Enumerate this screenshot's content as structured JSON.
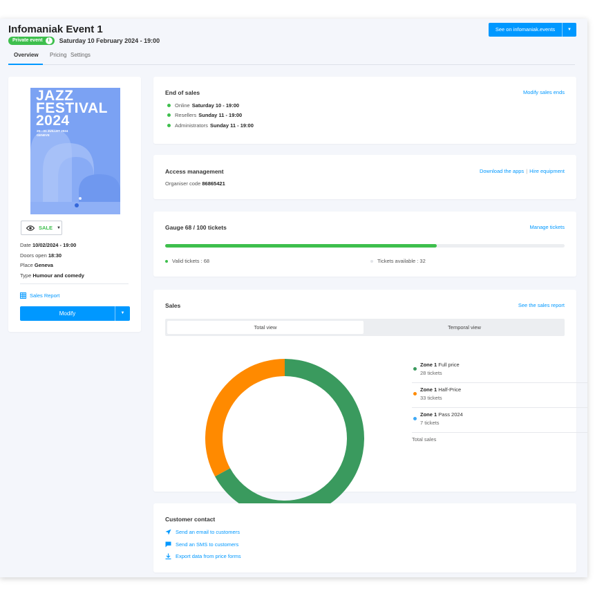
{
  "header": {
    "title": "Infomaniak Event 1",
    "badge_label": "Private event",
    "badge_icon": "i",
    "date": "Saturday 10 February 2024 - 19:00",
    "see_button_label": "See on infomaniak.events"
  },
  "tabs": [
    {
      "label": "Overview",
      "active": true
    },
    {
      "label": "Pricing",
      "active": false
    },
    {
      "label": "Settings",
      "active": false
    }
  ],
  "event_card": {
    "poster": {
      "line1": "JAZZ",
      "line2": "FESTIVAL",
      "line3": "2024",
      "dates": "29—31 JUILLET 2024",
      "city": "GENEVE"
    },
    "status_label": "SALE",
    "details": [
      {
        "label": "Date",
        "value": "10/02/2024 - 19:00"
      },
      {
        "label": "Doors open",
        "value": "18:30"
      },
      {
        "label": "Place",
        "value": "Geneva"
      },
      {
        "label": "Type",
        "value": "Humour and comedy"
      }
    ],
    "sales_report_label": "Sales Report",
    "modify_label": "Modify"
  },
  "end_of_sales": {
    "title": "End of sales",
    "link": "Modify sales ends",
    "items": [
      {
        "channel": "Online",
        "date": "Saturday 10 - 19:00"
      },
      {
        "channel": "Resellers",
        "date": "Sunday 11 - 19:00"
      },
      {
        "channel": "Administrators",
        "date": "Sunday 11 - 19:00"
      }
    ],
    "dot_color": "#3ebf4d"
  },
  "access": {
    "title": "Access management",
    "organiser_label": "Organiser code",
    "organiser_code": "86865421",
    "link_download": "Download the apps",
    "link_separator": "|",
    "link_hire": "Hire equipment"
  },
  "gauge": {
    "title": "Gauge 68 / 100 tickets",
    "link": "Manage tickets",
    "fill_fraction": 0.68,
    "valid_label": "Valid tickets : 68",
    "available_label": "Tickets available : 32",
    "fill_color": "#3ebf4d"
  },
  "sales": {
    "title": "Sales",
    "link": "See the sales report",
    "view_tabs": [
      {
        "label": "Total view",
        "active": true
      },
      {
        "label": "Temporal view",
        "active": false
      }
    ],
    "legend": [
      {
        "zone": "Zone 1",
        "name": "Full price",
        "count": "28 tickets",
        "color": "#3a9a5e"
      },
      {
        "zone": "Zone 1",
        "name": "Half-Price",
        "count": "33 tickets",
        "color": "#ff8a00"
      },
      {
        "zone": "Zone 1",
        "name": "Pass 2024",
        "count": "7 tickets",
        "color": "#3fa9f5"
      }
    ],
    "total_label": "Total sales"
  },
  "chart_data": {
    "type": "pie",
    "categories": [
      "Zone 1 Full price",
      "Zone 1 Half-Price"
    ],
    "values": [
      59,
      29
    ],
    "colors": [
      "#3a9a5e",
      "#ff8a00"
    ]
  },
  "contact": {
    "title": "Customer contact",
    "items": [
      {
        "label": "Send an email to customers",
        "icon": "send-icon"
      },
      {
        "label": "Send an SMS to customers",
        "icon": "chat-icon"
      },
      {
        "label": "Export data from price forms",
        "icon": "download-icon"
      }
    ]
  },
  "colors": {
    "accent": "#0098ff",
    "success": "#3ebf4d",
    "background": "#f4f6fb"
  }
}
